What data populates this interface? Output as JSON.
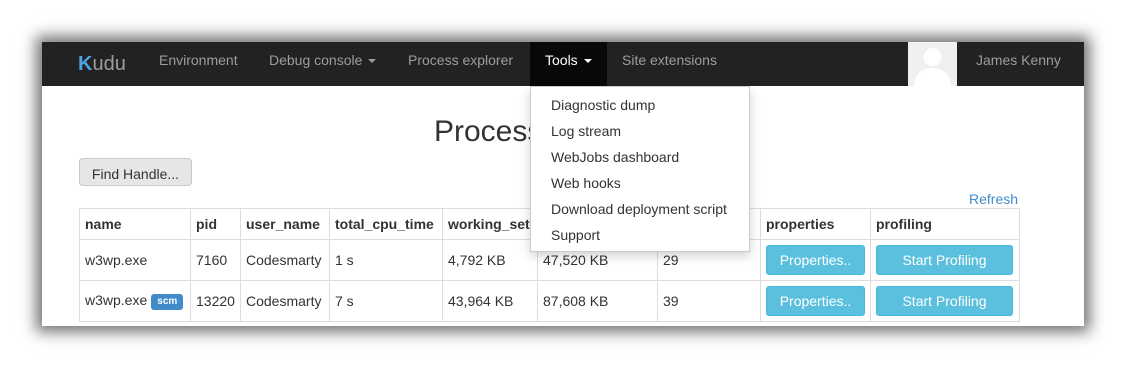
{
  "navbar": {
    "brand_initial": "K",
    "brand_rest": "udu",
    "items": [
      {
        "label": "Environment"
      },
      {
        "label": "Debug console"
      },
      {
        "label": "Process explorer"
      },
      {
        "label": "Tools"
      },
      {
        "label": "Site extensions"
      }
    ],
    "user_name": "James Kenny"
  },
  "tools_menu": {
    "items": [
      {
        "label": "Diagnostic dump"
      },
      {
        "label": "Log stream"
      },
      {
        "label": "WebJobs dashboard"
      },
      {
        "label": "Web hooks"
      },
      {
        "label": "Download deployment script"
      },
      {
        "label": "Support"
      }
    ]
  },
  "page": {
    "title": "Process",
    "find_handle_label": "Find Handle...",
    "refresh_label": "Refresh"
  },
  "table": {
    "headers": [
      "name",
      "pid",
      "user_name",
      "total_cpu_time",
      "working_set",
      "",
      "",
      "properties",
      "profiling"
    ],
    "rows": [
      {
        "name": "w3wp.exe",
        "badge": "",
        "pid": "7160",
        "user": "Codesmarty",
        "cpu": "1 s",
        "working_set": "4,792 KB",
        "col6": "47,520 KB",
        "col7": "29",
        "properties_label": "Properties..",
        "profiling_label": "Start Profiling"
      },
      {
        "name": "w3wp.exe",
        "badge": "scm",
        "pid": "13220",
        "user": "Codesmarty",
        "cpu": "7 s",
        "working_set": "43,964 KB",
        "col6": "87,608 KB",
        "col7": "39",
        "properties_label": "Properties..",
        "profiling_label": "Start Profiling"
      }
    ]
  },
  "colors": {
    "navbar_bg": "#222222",
    "active_nav_bg": "#080808",
    "link": "#428bca",
    "info_button": "#5bc0de"
  }
}
